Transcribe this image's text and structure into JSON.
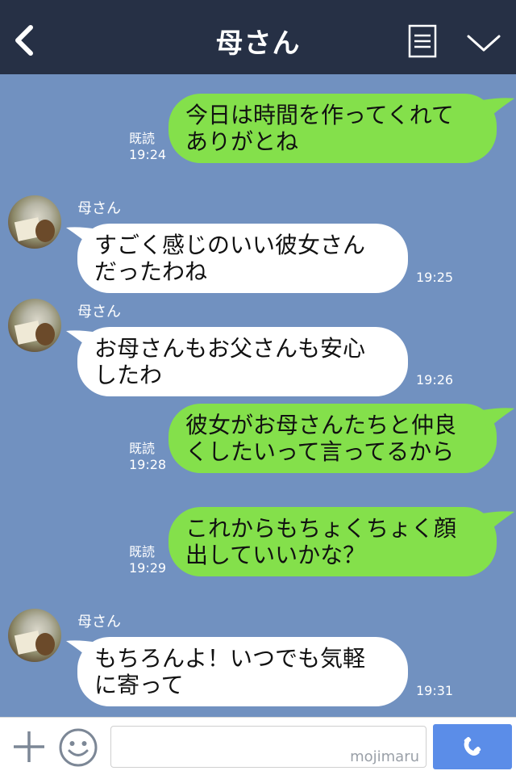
{
  "header": {
    "title": "母さん",
    "back_icon": "chevron-left-icon",
    "menu_icon": "menu-list-icon",
    "collapse_icon": "chevron-down-icon"
  },
  "messages": [
    {
      "side": "out",
      "text": "今日は時間を作ってくれて\nありがとね",
      "read": "既読",
      "time": "19:24"
    },
    {
      "side": "in",
      "sender": "母さん",
      "text": "すごく感じのいい彼女さん\nだったわね",
      "time": "19:25"
    },
    {
      "side": "in",
      "sender": "母さん",
      "text": "お母さんもお父さんも安心\nしたわ",
      "time": "19:26"
    },
    {
      "side": "out",
      "text": "彼女がお母さんたちと仲良\nくしたいって言ってるから",
      "read": "既読",
      "time": "19:28"
    },
    {
      "side": "out",
      "text": "これからもちょくちょく顔\n出していいかな？",
      "read": "既読",
      "time": "19:29"
    },
    {
      "side": "in",
      "sender": "母さん",
      "text": "もちろんよ！いつでも気軽\nに寄って",
      "time": "19:31"
    }
  ],
  "footer": {
    "input_value": "",
    "watermark": "mojimaru",
    "plus_icon": "plus-icon",
    "emoji_icon": "smiley-icon",
    "call_icon": "phone-icon"
  },
  "colors": {
    "header_bg": "#263045",
    "chat_bg": "#7191c0",
    "outgoing_bubble": "#84e04b",
    "incoming_bubble": "#ffffff",
    "call_button": "#5b8de8"
  }
}
